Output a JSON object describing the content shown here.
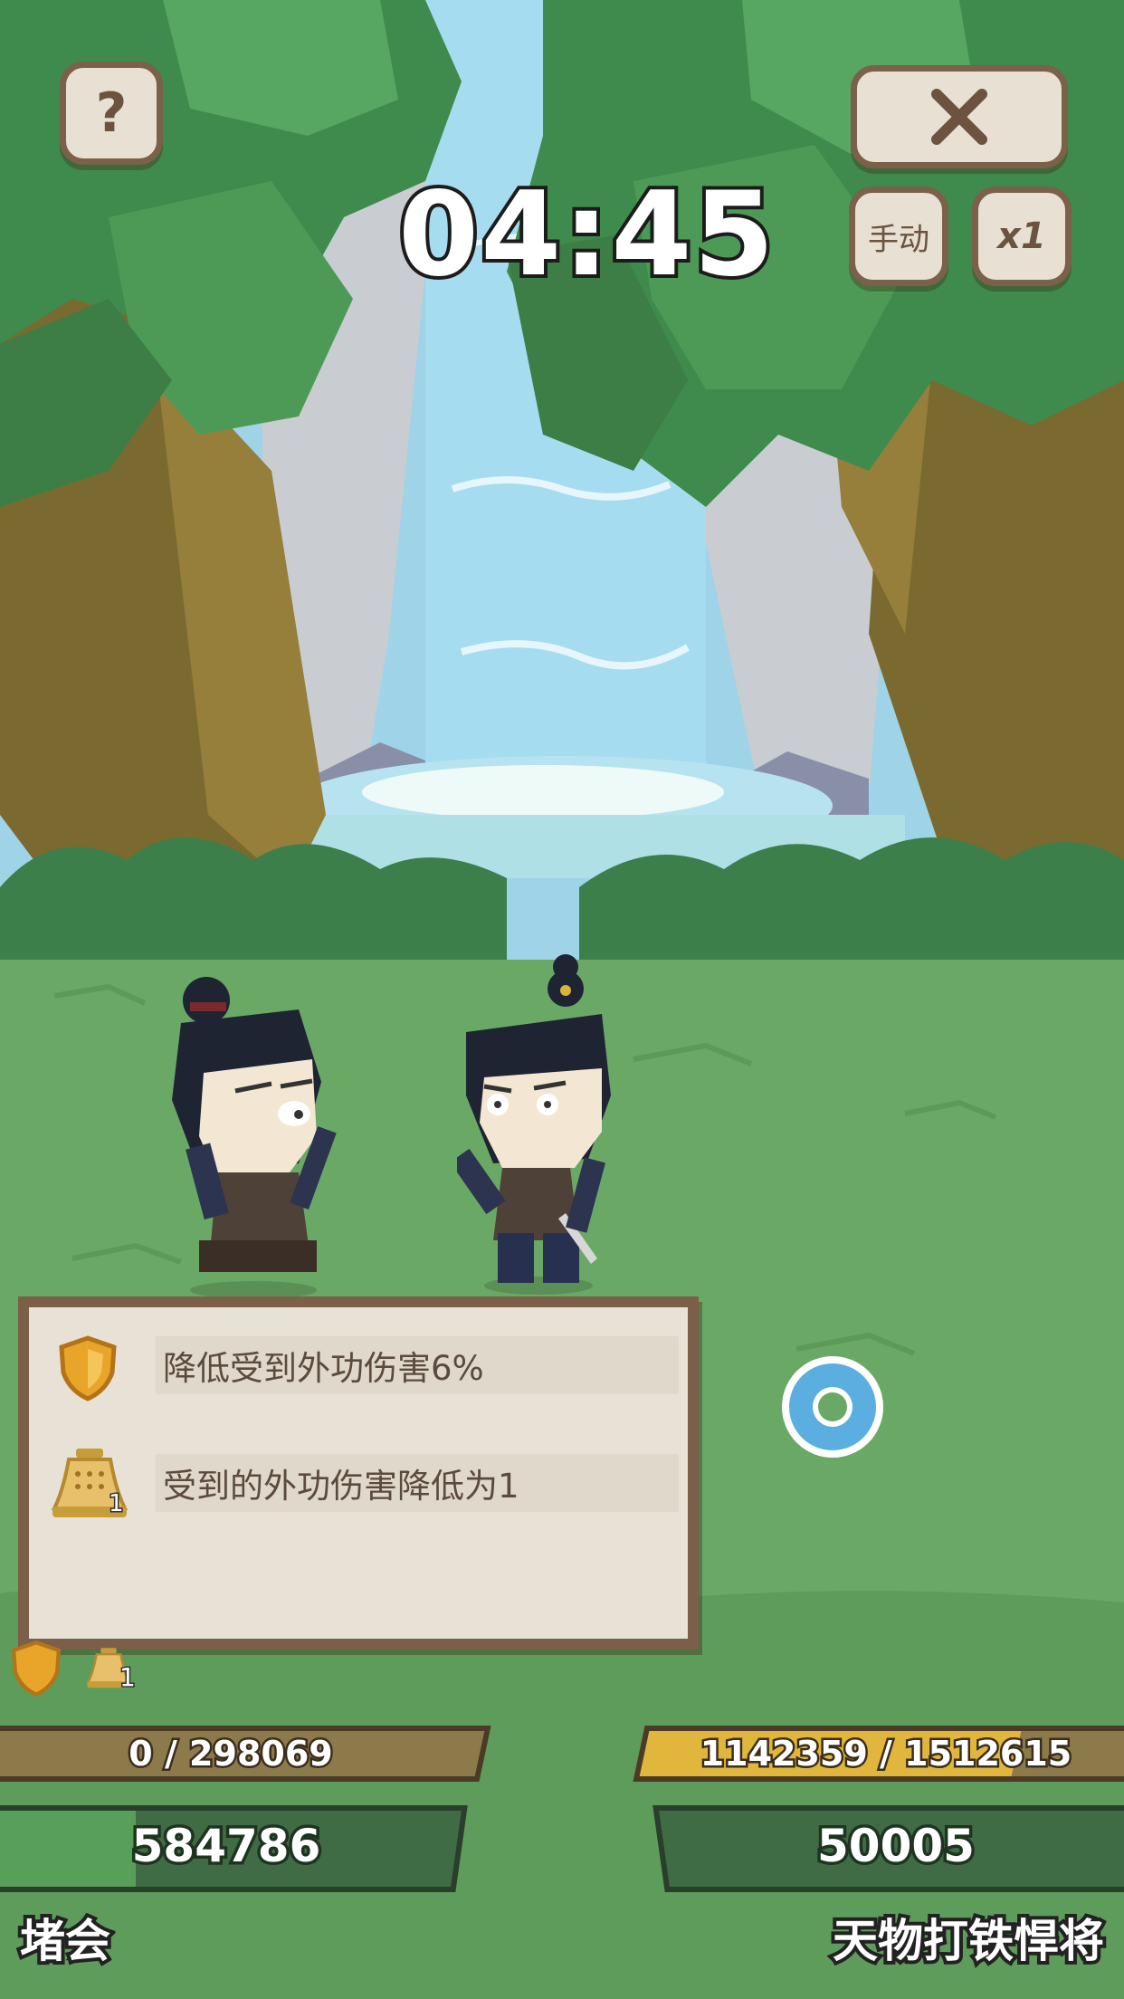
{
  "hud": {
    "timer": "04:45",
    "help_label": "?",
    "mode_label": "手动",
    "speed_label": "x1"
  },
  "buff_panel": {
    "items": [
      {
        "icon": "shield-icon",
        "text": "降低受到外功伤害6%"
      },
      {
        "icon": "bell-icon",
        "badge": "1",
        "text": "受到的外功伤害降低为1"
      }
    ]
  },
  "player": {
    "name": "堵会",
    "shield_value": "0 / 298069",
    "power": "584786",
    "status_icons": [
      {
        "icon": "shield-icon"
      },
      {
        "icon": "bell-icon",
        "badge": "1"
      }
    ]
  },
  "enemy": {
    "name": "天物打铁悍将",
    "hp_value": "1142359 / 1512615",
    "hp_fraction": 0.755,
    "power": "50005"
  },
  "colors": {
    "panel_bg": "#e8e2d6",
    "panel_border": "#7b5f48",
    "bar_gold": "#e0b63c",
    "bar_dark_gold": "#8d7a4a",
    "power_bar": "#3f6b45",
    "grass": "#6aa865"
  }
}
